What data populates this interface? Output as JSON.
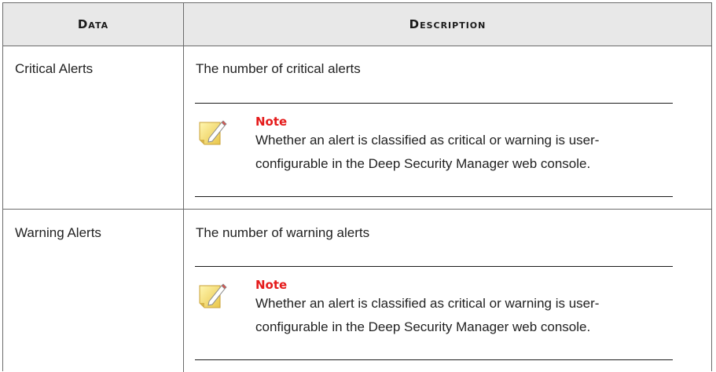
{
  "table": {
    "headers": {
      "data": "Data",
      "description": "Description"
    },
    "rows": [
      {
        "data": "Critical Alerts",
        "description": "The number of critical alerts",
        "note": {
          "icon": "note-pencil-icon",
          "title": "Note",
          "body": "Whether an alert is classified as critical or warning is user-configurable in the Deep Security Manager web console."
        }
      },
      {
        "data": "Warning Alerts",
        "description": "The number of warning alerts",
        "note": {
          "icon": "note-pencil-icon",
          "title": "Note",
          "body": "Whether an alert is classified as critical or warning is user-configurable in the Deep Security Manager web console."
        }
      }
    ]
  },
  "colors": {
    "note_title": "#e51b1b",
    "header_bg": "#e8e8e8",
    "border": "#6b6b6b"
  }
}
